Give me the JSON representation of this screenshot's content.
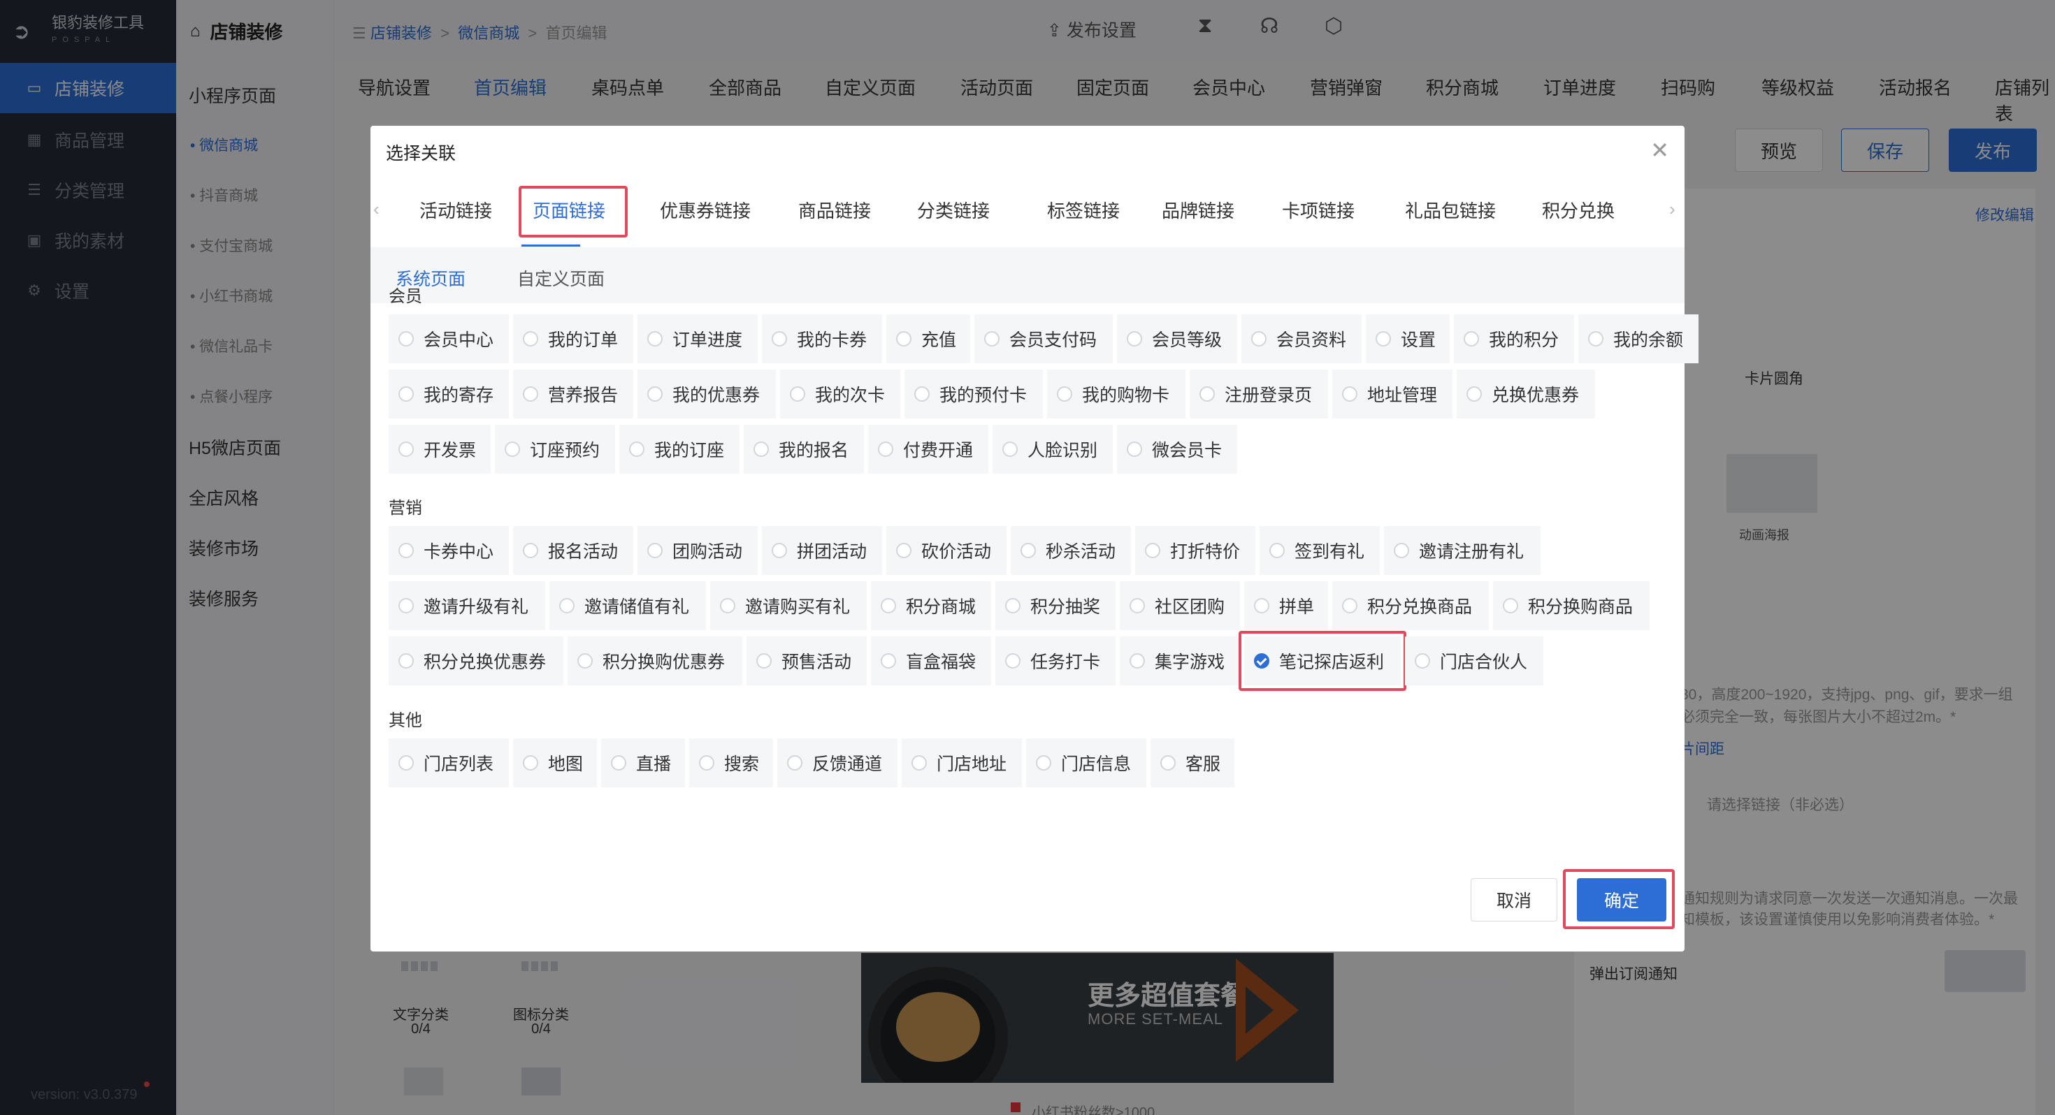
{
  "brand": {
    "name": "银豹装修工具",
    "sub": "POSPAL"
  },
  "leftnav": {
    "items": [
      {
        "label": "店铺装修",
        "icon": "store-icon"
      },
      {
        "label": "商品管理",
        "icon": "grid-icon"
      },
      {
        "label": "分类管理",
        "icon": "list-icon"
      },
      {
        "label": "我的素材",
        "icon": "image-icon"
      },
      {
        "label": "设置",
        "icon": "gear-icon"
      }
    ],
    "version": "version: v3.0.379"
  },
  "subnav": {
    "title": "店铺装修",
    "items": [
      {
        "label": "小程序页面"
      },
      {
        "label": "微信商城"
      },
      {
        "label": "抖音商城"
      },
      {
        "label": "支付宝商城"
      },
      {
        "label": "小红书商城"
      },
      {
        "label": "微信礼品卡"
      },
      {
        "label": "点餐小程序"
      },
      {
        "label": "H5微店页面"
      },
      {
        "label": "全店风格"
      },
      {
        "label": "装修市场"
      },
      {
        "label": "装修服务"
      }
    ]
  },
  "breadcrumb": {
    "a": "店铺装修",
    "sep": ">",
    "b": "微信商城",
    "c": "首页编辑"
  },
  "topbar": {
    "publish_settings": "发布设置"
  },
  "tabs": [
    "导航设置",
    "首页编辑",
    "桌码点单",
    "全部商品",
    "自定义页面",
    "活动页面",
    "固定页面",
    "会员中心",
    "营销弹窗",
    "积分商城",
    "订单进度",
    "扫码购",
    "等级权益",
    "活动报名",
    "店铺列表"
  ],
  "actions": {
    "preview": "预览",
    "save": "保存",
    "publish": "发布"
  },
  "rightpanel": {
    "edit": "修改编辑",
    "card_corner": "卡片圆角",
    "anim_poster": "动画海报",
    "hint1": "30，高度200~1920，支持jpg、png、gif，要求一组",
    "hint2": "必须完全一致，每张图片大小不超过2m。*",
    "spacing": "片间距",
    "link_placeholder": "请选择链接（非必选）",
    "notice1": "通知规则为请求同意一次发送一次通知消息。一次最",
    "notice2": "知模板，该设置谨慎使用以免影响消费者体验。*",
    "popup_notice": "弹出订阅通知"
  },
  "canvas": {
    "banner_title": "更多超值套餐",
    "banner_sub": "MORE SET-MEAL",
    "xhs_line": "小红书粉丝数>1000",
    "cat1": "文字分类",
    "cat1_count": "0/4",
    "cat2": "图标分类",
    "cat2_count": "0/4"
  },
  "modal": {
    "title": "选择关联",
    "link_tabs": [
      "活动链接",
      "页面链接",
      "优惠券链接",
      "商品链接",
      "分类链接",
      "标签链接",
      "品牌链接",
      "卡项链接",
      "礼品包链接",
      "积分兑换"
    ],
    "sub_tabs": [
      "系统页面",
      "自定义页面"
    ],
    "sections": [
      {
        "title": "会员",
        "rows": [
          [
            "会员中心",
            "我的订单",
            "订单进度",
            "我的卡券",
            "充值",
            "会员支付码",
            "会员等级",
            "会员资料",
            "设置",
            "我的积分",
            "我的余额"
          ],
          [
            "我的寄存",
            "营养报告",
            "我的优惠券",
            "我的次卡",
            "我的预付卡",
            "我的购物卡",
            "注册登录页",
            "地址管理",
            "兑换优惠券"
          ],
          [
            "开发票",
            "订座预约",
            "我的订座",
            "我的报名",
            "付费开通",
            "人脸识别",
            "微会员卡"
          ]
        ]
      },
      {
        "title": "营销",
        "rows": [
          [
            "卡券中心",
            "报名活动",
            "团购活动",
            "拼团活动",
            "砍价活动",
            "秒杀活动",
            "打折特价",
            "签到有礼",
            "邀请注册有礼"
          ],
          [
            "邀请升级有礼",
            "邀请储值有礼",
            "邀请购买有礼",
            "积分商城",
            "积分抽奖",
            "社区团购",
            "拼单",
            "积分兑换商品",
            "积分换购商品"
          ],
          [
            "积分兑换优惠券",
            "积分换购优惠券",
            "预售活动",
            "盲盒福袋",
            "任务打卡",
            "集字游戏",
            "笔记探店返利",
            "门店合伙人"
          ]
        ]
      },
      {
        "title": "其他",
        "rows": [
          [
            "门店列表",
            "地图",
            "直播",
            "搜索",
            "反馈通道",
            "门店地址",
            "门店信息",
            "客服"
          ]
        ]
      }
    ],
    "selected": "笔记探店返利",
    "cancel": "取消",
    "confirm": "确定"
  },
  "colors": {
    "accent": "#2d6dd6",
    "highlight": "#e04a5c",
    "sidebar": "#252b36"
  }
}
